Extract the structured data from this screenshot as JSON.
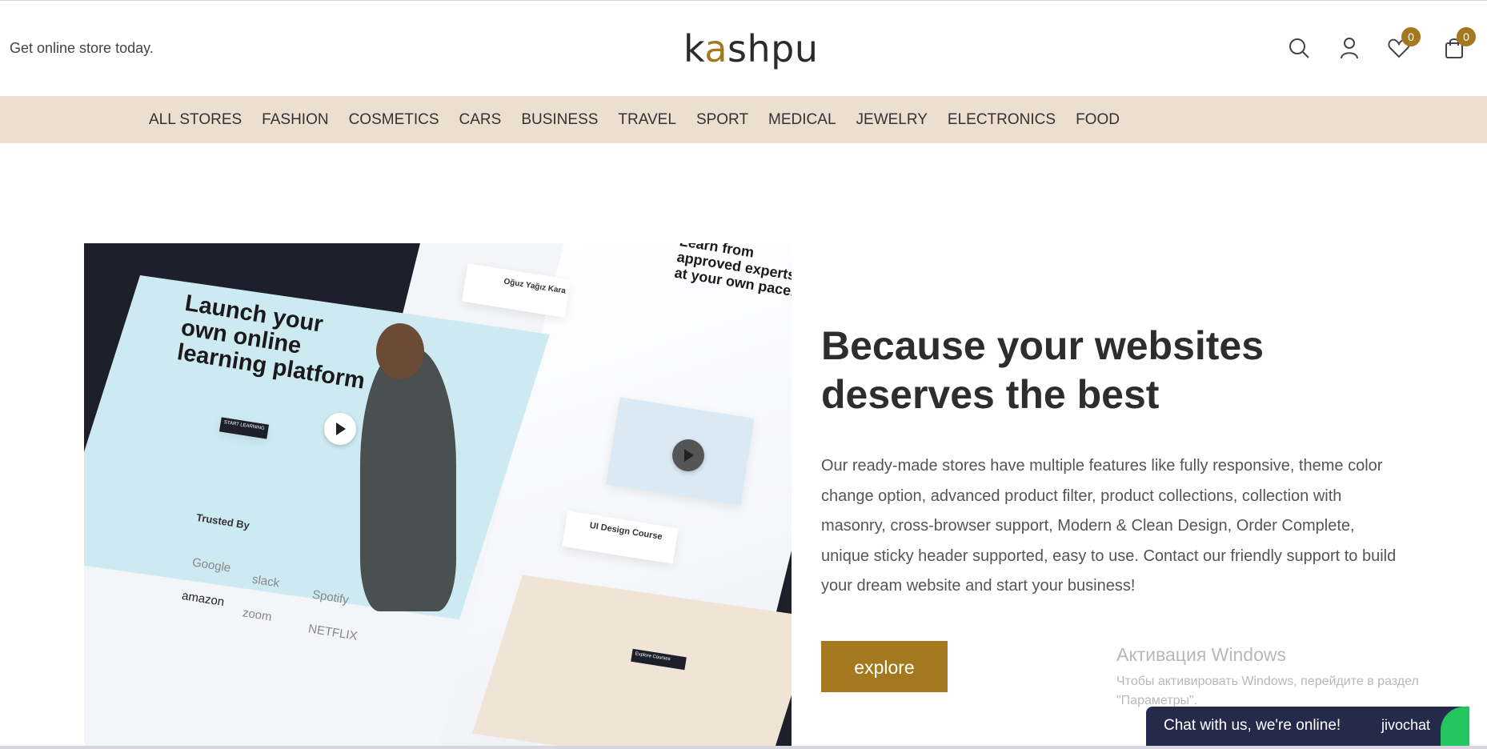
{
  "header": {
    "tagline": "Get online store today.",
    "logo_prefix": "k",
    "logo_accent": "a",
    "logo_suffix": "shpu",
    "wishlist_count": "0",
    "cart_count": "0"
  },
  "nav": {
    "items": [
      "ALL STORES",
      "FASHION",
      "COSMETICS",
      "CARS",
      "BUSINESS",
      "TRAVEL",
      "SPORT",
      "MEDICAL",
      "JEWELRY",
      "ELECTRONICS",
      "FOOD"
    ]
  },
  "hero": {
    "image": {
      "headline": "Launch your own online learning platform",
      "side_text": "Learn from approved experts at your own pace.",
      "instructor_name": "Oğuz Yağız Kara",
      "course_name": "UI Design Course",
      "trusted_by": "Trusted By",
      "brands": [
        "Google",
        "slack",
        "Spotify",
        "amazon",
        "zoom",
        "NETFLIX"
      ],
      "cta": "START LEARNING",
      "explore_courses": "Explore Courses"
    },
    "title": "Because your websites deserves the best",
    "description": "Our ready-made stores have multiple features like fully responsive, theme color change option, advanced product filter, product collections, collection with masonry, cross-browser support, Modern & Clean Design, Order Complete, unique sticky header supported, easy to use. Contact our friendly support to build your dream website and start your business!",
    "button_label": "explore"
  },
  "windows_activation": {
    "title": "Активация Windows",
    "subtitle": "Чтобы активировать Windows, перейдите в раздел \"Параметры\"."
  },
  "chat": {
    "message": "Chat with us, we're online!",
    "brand": "jivochat"
  },
  "colors": {
    "accent": "#a4781e",
    "nav_bg": "#eddfd0",
    "chat_bg": "#262a4a"
  }
}
